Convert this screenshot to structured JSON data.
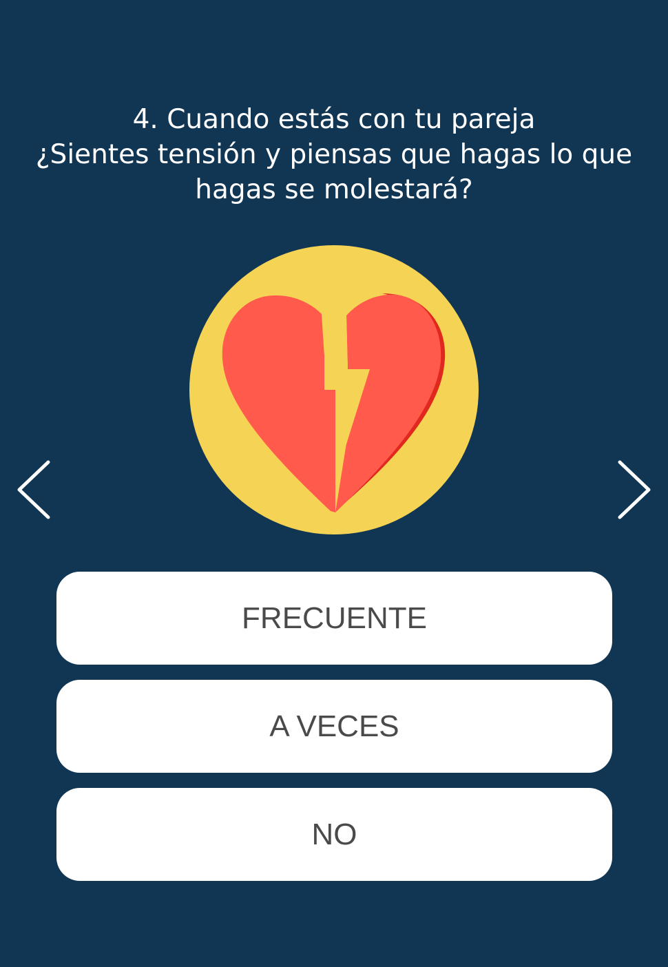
{
  "question": {
    "lines": [
      "4. Cuando estás con tu pareja",
      "¿Sientes tensión y piensas que hagas lo que",
      "hagas se molestará?"
    ]
  },
  "illustration": {
    "icon": "broken-heart-icon",
    "circle_color": "#F5D354",
    "heart_color": "#FF5A4B",
    "heart_shadow_color": "#E0281E"
  },
  "navigation": {
    "prev_icon": "chevron-left-icon",
    "next_icon": "chevron-right-icon"
  },
  "answers": [
    {
      "label": "FRECUENTE"
    },
    {
      "label": "A VECES"
    },
    {
      "label": "NO"
    }
  ],
  "colors": {
    "background": "#113653",
    "button_text": "#4A4A4A"
  }
}
